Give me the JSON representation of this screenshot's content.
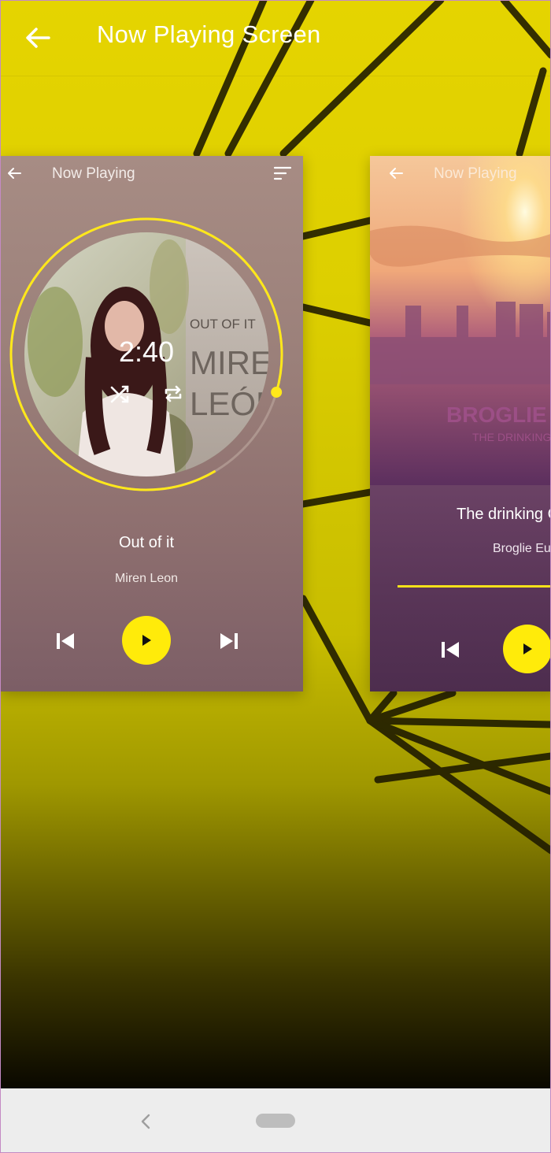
{
  "app_bar": {
    "title": "Now Playing Screen",
    "back_icon": "arrow-left-icon"
  },
  "cards": [
    {
      "header_title": "Now Playing",
      "menu_icon": "sort-menu-icon",
      "time": "2:40",
      "album_cover_text": [
        "OUT OF IT",
        "MIREN",
        "LEÓN"
      ],
      "song_title": "Out of it",
      "artist": "Miren Leon",
      "progress": 0.88
    },
    {
      "header_title": "Now Playing",
      "album_cover_text": [
        "BROGLIE",
        "THE DRINKING"
      ],
      "song_title": "The drinking C",
      "artist": "Broglie Eu"
    }
  ],
  "colors": {
    "accent": "#ffeb0a",
    "background": "#e5d400",
    "nav_bar": "#ededed"
  }
}
